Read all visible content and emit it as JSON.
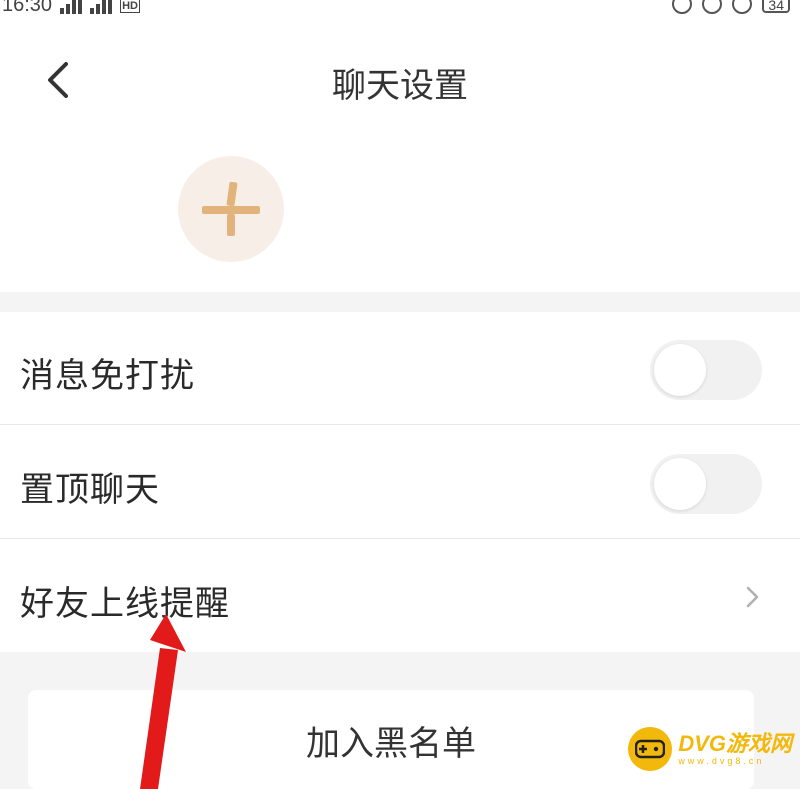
{
  "status_bar": {
    "time": "16:30",
    "network": "HD",
    "battery": "34"
  },
  "nav": {
    "title": "聊天设置"
  },
  "settings": [
    {
      "label": "消息免打扰",
      "control": "toggle",
      "on": false
    },
    {
      "label": "置顶聊天",
      "control": "toggle",
      "on": false
    },
    {
      "label": "好友上线提醒",
      "control": "chevron"
    }
  ],
  "blacklist": {
    "label": "加入黑名单"
  },
  "colors": {
    "add_icon": "#e2b47c",
    "add_bg": "#f7efe7",
    "arrow": "#e21a1a",
    "watermark": "#f3b80c"
  },
  "watermark": {
    "brand": "DVG游戏网",
    "sub": "www.dvg8.cn"
  }
}
